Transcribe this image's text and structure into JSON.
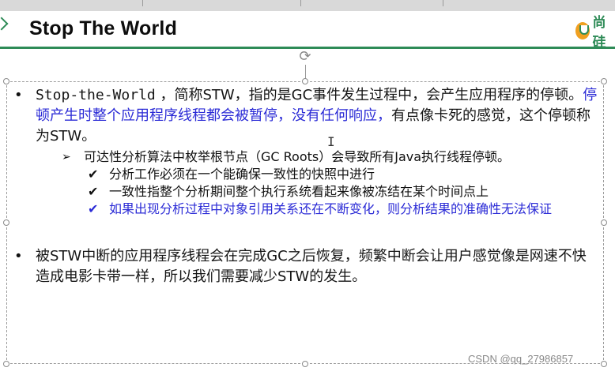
{
  "slide": {
    "title": "Stop The World",
    "brand_text": "尚硅",
    "bullets": [
      {
        "lead": "Stop-the-World",
        "text_a": " ，简称STW，指的是GC事件发生过程中，会产生应用程序的停顿。",
        "text_blue": "停顿产生时整个应用程序线程都会被暂停，没有任何响应，",
        "text_b": "有点像卡死的感觉，这个停顿称为STW。"
      },
      {
        "text": "被STW中断的应用程序线程会在完成GC之后恢复，频繁中断会让用户感觉像是网速不快造成电影卡带一样，所以我们需要减少STW的发生。"
      }
    ],
    "sub_point": "可达性分析算法中枚举根节点（GC Roots）会导致所有Java执行线程停顿。",
    "checks": [
      "分析工作必须在一个能确保一致性的快照中进行",
      "一致性指整个分析期间整个执行系统看起来像被冻结在某个时间点上",
      "如果出现分析过程中对象引用关系还在不断变化，则分析结果的准确性无法保证"
    ],
    "bullet_glyph": "•",
    "arrow_glyph": "➢",
    "check_glyph": "✔"
  },
  "watermark": "CSDN @qq_27986857",
  "colors": {
    "accent_green": "#2e8b57",
    "highlight_blue": "#2b2bd6",
    "logo_orange": "#f0a020"
  },
  "icons": {
    "header_chevron": "chevron-right-icon",
    "rotate": "rotate-handle-icon",
    "text_cursor": "text-cursor-icon"
  }
}
